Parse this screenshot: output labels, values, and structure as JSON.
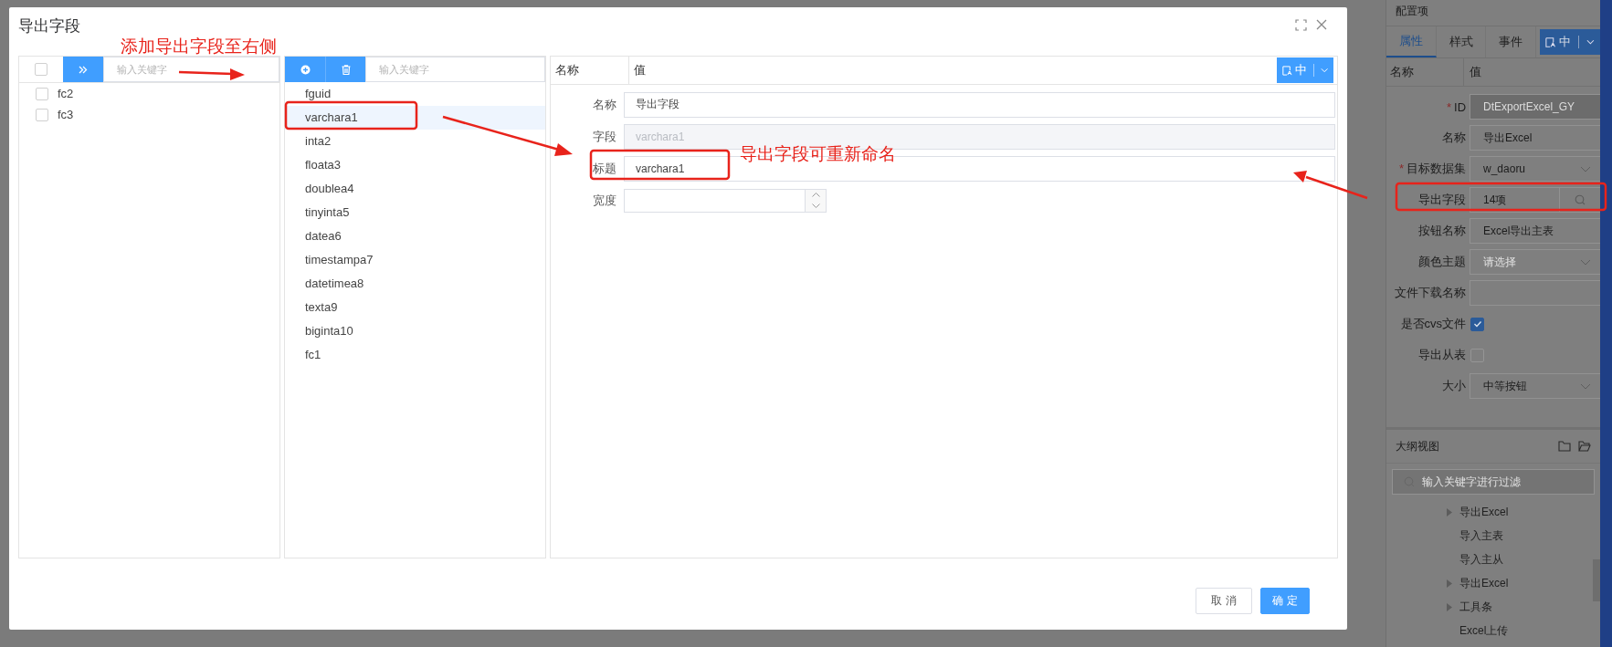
{
  "dialog": {
    "title": "导出字段",
    "left_pane": {
      "select_all_checked": false,
      "search_placeholder": "输入关键字",
      "items": [
        {
          "label": "fc2",
          "checked": false
        },
        {
          "label": "fc3",
          "checked": false
        }
      ]
    },
    "middle_pane": {
      "search_placeholder": "输入关键字",
      "items": [
        {
          "label": "fguid",
          "selected": false
        },
        {
          "label": "varchara1",
          "selected": true
        },
        {
          "label": "inta2",
          "selected": false
        },
        {
          "label": "floata3",
          "selected": false
        },
        {
          "label": "doublea4",
          "selected": false
        },
        {
          "label": "tinyinta5",
          "selected": false
        },
        {
          "label": "datea6",
          "selected": false
        },
        {
          "label": "timestampa7",
          "selected": false
        },
        {
          "label": "datetimea8",
          "selected": false
        },
        {
          "label": "texta9",
          "selected": false
        },
        {
          "label": "biginta10",
          "selected": false
        },
        {
          "label": "fc1",
          "selected": false
        }
      ]
    },
    "detail_pane": {
      "columns": [
        "名称",
        "值"
      ],
      "language_button": "中",
      "rows": [
        {
          "label": "名称",
          "kind": "text",
          "value": "导出字段",
          "disabled": false
        },
        {
          "label": "字段",
          "kind": "text",
          "value": "varchara1",
          "disabled": true
        },
        {
          "label": "标题",
          "kind": "text",
          "value": "varchara1",
          "disabled": false
        },
        {
          "label": "宽度",
          "kind": "number"
        }
      ]
    },
    "buttons": [
      {
        "label": "取 消",
        "primary": false
      },
      {
        "label": "确 定",
        "primary": true
      }
    ]
  },
  "config_panel": {
    "title": "配置项",
    "tabs": [
      {
        "label": "属性",
        "selected": true
      },
      {
        "label": "样式",
        "selected": false
      },
      {
        "label": "事件",
        "selected": false
      }
    ],
    "language_button": "中",
    "columns": [
      "名称",
      "值"
    ],
    "properties": [
      {
        "label": "ID",
        "required_mark": "*",
        "kind": "text",
        "value": "DtExportExcel_GY",
        "disabled": true
      },
      {
        "label": "名称",
        "kind": "text",
        "value": "导出Excel",
        "disabled": false
      },
      {
        "label": "目标数据集",
        "required_mark": "*",
        "kind": "select",
        "value": "w_daoru",
        "disabled": false
      },
      {
        "label": "导出字段",
        "kind": "search",
        "value": "14项",
        "disabled": false
      },
      {
        "label": "按钮名称",
        "kind": "text",
        "value": "Excel导出主表",
        "disabled": false
      },
      {
        "label": "颜色主题",
        "kind": "select",
        "placeholder": "请选择",
        "disabled": false
      },
      {
        "label": "文件下载名称",
        "kind": "text",
        "disabled": false
      },
      {
        "label": "是否cvs文件",
        "kind": "checkbox",
        "checked": true
      },
      {
        "label": "导出从表",
        "kind": "checkbox",
        "checked": false
      },
      {
        "label": "大小",
        "kind": "select",
        "value": "中等按钮",
        "disabled": false
      }
    ],
    "outline": {
      "title": "大纲视图",
      "search_placeholder": "输入关键字进行过滤",
      "items": [
        {
          "label": "导出Excel",
          "expandable": true
        },
        {
          "label": "导入主表",
          "expandable": false
        },
        {
          "label": "导入主从",
          "expandable": false
        },
        {
          "label": "导出Excel",
          "expandable": true
        },
        {
          "label": "工具条",
          "expandable": true
        },
        {
          "label": "Excel上传",
          "expandable": false
        }
      ]
    }
  },
  "annotations": [
    {
      "text": "添加导出字段至右侧"
    },
    {
      "text": "导出字段可重新命名"
    }
  ]
}
